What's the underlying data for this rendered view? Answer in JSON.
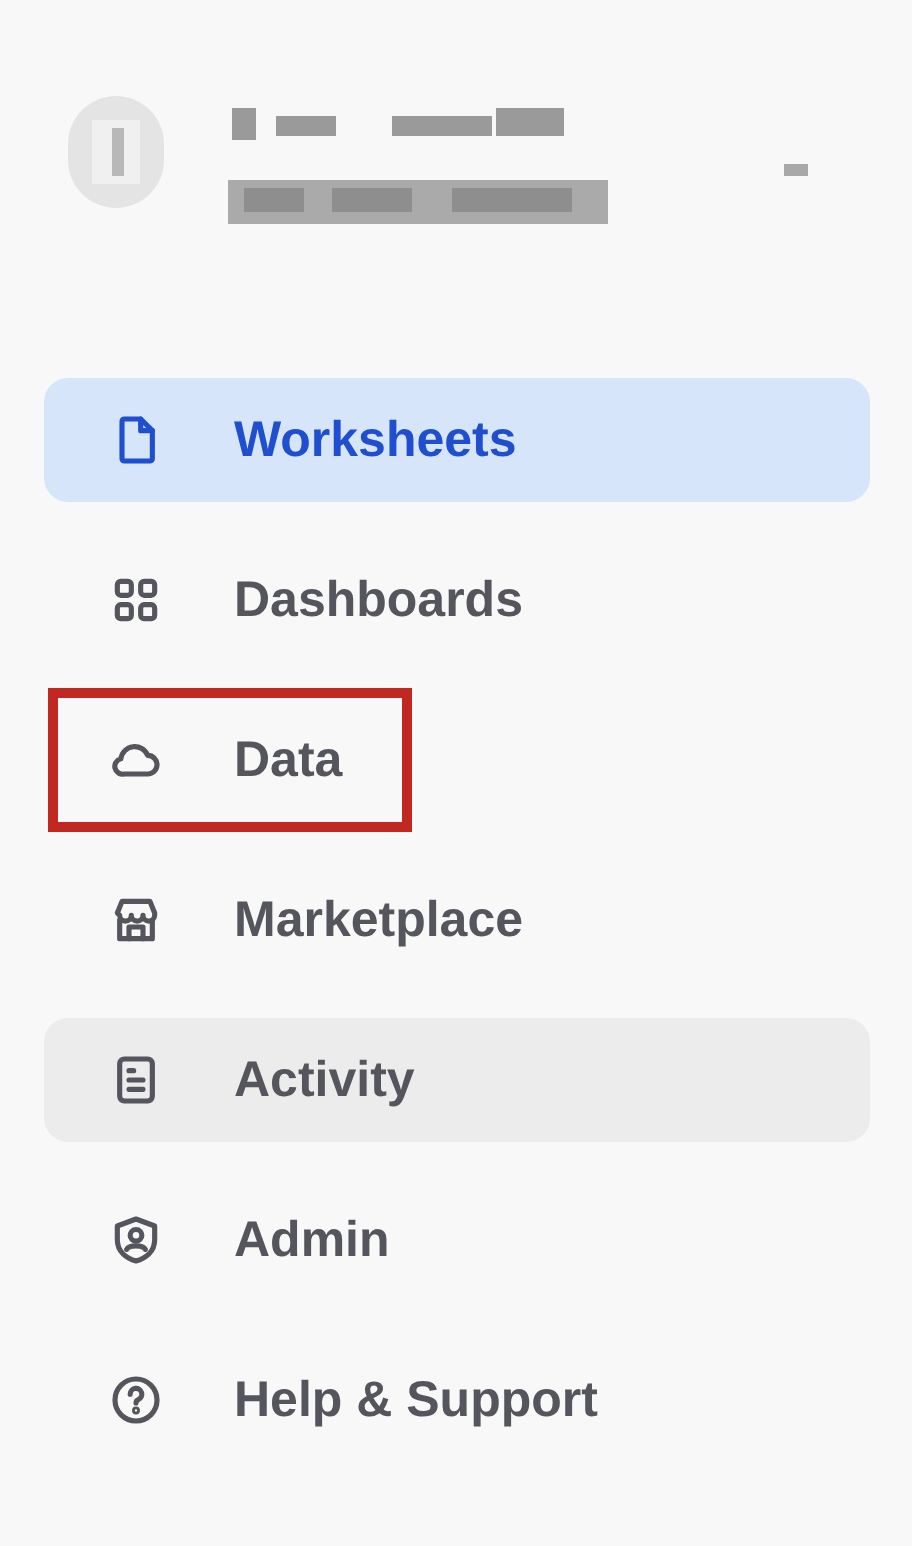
{
  "nav": [
    {
      "label": "Worksheets",
      "kind": "document",
      "selected": true,
      "hovered": false,
      "annotated": false
    },
    {
      "label": "Dashboards",
      "kind": "grid",
      "selected": false,
      "hovered": false,
      "annotated": false
    },
    {
      "label": "Data",
      "kind": "cloud",
      "selected": false,
      "hovered": false,
      "annotated": true
    },
    {
      "label": "Marketplace",
      "kind": "store",
      "selected": false,
      "hovered": false,
      "annotated": false
    },
    {
      "label": "Activity",
      "kind": "list",
      "selected": false,
      "hovered": true,
      "annotated": false
    },
    {
      "label": "Admin",
      "kind": "shield",
      "selected": false,
      "hovered": false,
      "annotated": false
    },
    {
      "label": "Help & Support",
      "kind": "help",
      "selected": false,
      "hovered": false,
      "annotated": false
    }
  ]
}
